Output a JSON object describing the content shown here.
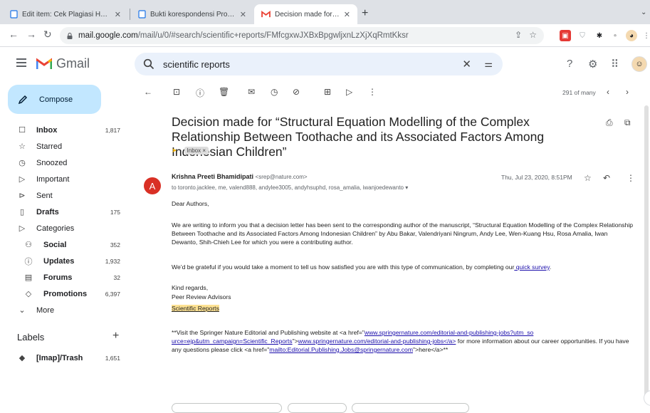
{
  "browser": {
    "tabs": [
      {
        "title": "Edit item: Cek Plagiasi Healthcare"
      },
      {
        "title": "Bukti korespondensi Processes"
      },
      {
        "title": "Decision made for “Structural Equation"
      }
    ],
    "new_tab": "+",
    "url_host": "mail.google.com",
    "url_path": "/mail/u/0/#search/scientific+reports/FMfcgxwJXBxBpgwljxnLzXjXqRmtKksr"
  },
  "gmail": {
    "logo_word": "Gmail",
    "search_query": "scientific reports",
    "compose_label": "Compose",
    "nav": [
      {
        "label": "Inbox",
        "count": "1,817",
        "icon": "inbox-icon",
        "glyph": "☐",
        "bold": true
      },
      {
        "label": "Starred",
        "count": "",
        "icon": "star-icon",
        "glyph": "☆",
        "bold": false
      },
      {
        "label": "Snoozed",
        "count": "",
        "icon": "clock-icon",
        "glyph": "◷",
        "bold": false
      },
      {
        "label": "Important",
        "count": "",
        "icon": "important-icon",
        "glyph": "▷",
        "bold": false
      },
      {
        "label": "Sent",
        "count": "",
        "icon": "send-icon",
        "glyph": "⊳",
        "bold": false
      },
      {
        "label": "Drafts",
        "count": "175",
        "icon": "draft-icon",
        "glyph": "▯",
        "bold": true
      },
      {
        "label": "Categories",
        "count": "",
        "icon": "label-icon",
        "glyph": "▷",
        "bold": false
      }
    ],
    "categories": [
      {
        "label": "Social",
        "count": "352",
        "icon": "social-icon",
        "glyph": "⚇"
      },
      {
        "label": "Updates",
        "count": "1,932",
        "icon": "info-icon",
        "glyph": "ⓘ"
      },
      {
        "label": "Forums",
        "count": "32",
        "icon": "forum-icon",
        "glyph": "▤"
      },
      {
        "label": "Promotions",
        "count": "6,397",
        "icon": "tag-icon",
        "glyph": "◇"
      }
    ],
    "more_label": "More",
    "labels_heading": "Labels",
    "labels": [
      {
        "label": "[Imap]/Trash",
        "count": "1,651"
      }
    ]
  },
  "message": {
    "pager": "291 of many",
    "subject": "Decision made for “Structural Equation Modelling of the Complex Relationship Between Toothache and its Associated Factors Among Indonesian Children”",
    "label_chip": "Inbox ×",
    "sender_initial": "A",
    "sender_name": "Krishna Preeti Bhamidipati",
    "sender_email": "<srep@nature.com>",
    "recipients": "to toronto.jacklee, me, valend888, andylee3005, andyhsuphd, rosa_amalia, iwanjoedewanto ▾",
    "date": "Thu, Jul 23, 2020, 8:51PM",
    "greeting": "Dear Authors,",
    "para1": "We are writing to inform you that a decision letter has been sent to the corresponding author of the manuscript, “Structural Equation Modelling of the Complex Relationship Between Toothache and its Associated Factors Among Indonesian Children” by Abu Bakar, Valendriyani Ningrum, Andy Lee, Wen-Kuang Hsu, Rosa Amalia, Iwan Dewanto, Shih-Chieh Lee for which you were a contributing author.",
    "para2_text": "We’d be grateful if you would take a moment to tell us how satisfied you are with this type of communication, by completing our",
    "para2_link": " quick survey",
    "para2_end": ".",
    "regards": "Kind regards,",
    "team": "Peer Review Advisors",
    "journal": "Scientific Reports",
    "footer_a": "**Visit the Springer Nature Editorial and Publishing website at <a href=\"",
    "footer_link1": "www.springernature.com/editorial-and-publishing-jobs?utm_so urce=ejp&utm_campaign=Scientific_Reports",
    "footer_b": "\">",
    "footer_link2": "www.springernature.com/editorial-and-publishing-jobs</a>",
    "footer_c": " for more information about our career opportunities. If you have any questions please click <a href=\"",
    "footer_link3": "mailto:Editorial.Publishing.Jobs@springernature.com",
    "footer_d": "\">here</a>**"
  }
}
